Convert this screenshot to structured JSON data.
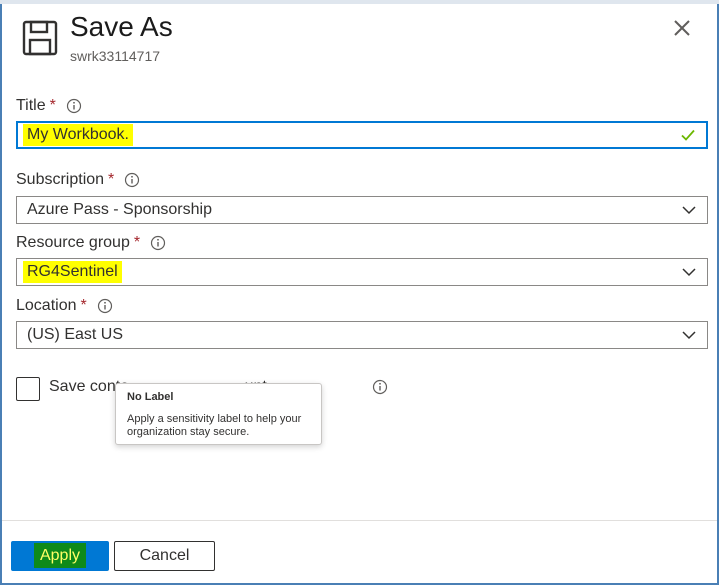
{
  "dialog": {
    "title": "Save As",
    "subtitle": "swrk33114717",
    "close_label": "Close"
  },
  "fields": {
    "title": {
      "label": "Title",
      "required": "*",
      "value": "My Workbook."
    },
    "subscription": {
      "label": "Subscription",
      "required": "*",
      "value": "Azure Pass - Sponsorship"
    },
    "resource_group": {
      "label": "Resource group",
      "required": "*",
      "value": "RG4Sentinel"
    },
    "location": {
      "label": "Location",
      "required": "*",
      "value": "(US) East US"
    }
  },
  "checkbox": {
    "label": "Save conte                          unt."
  },
  "tooltip": {
    "title": "No Label",
    "body": "Apply a sensitivity label to help your organization stay secure."
  },
  "footer": {
    "apply_label": "Apply",
    "cancel_label": "Cancel"
  },
  "colors": {
    "accent": "#0078d4",
    "highlight": "#ffff00",
    "valid_check": "#6bb700",
    "required": "#a4262c"
  },
  "icons": {
    "header": "save-floppy-icon",
    "close": "close-icon",
    "info": "info-icon",
    "valid": "checkmark-icon",
    "dropdown": "chevron-down-icon"
  }
}
